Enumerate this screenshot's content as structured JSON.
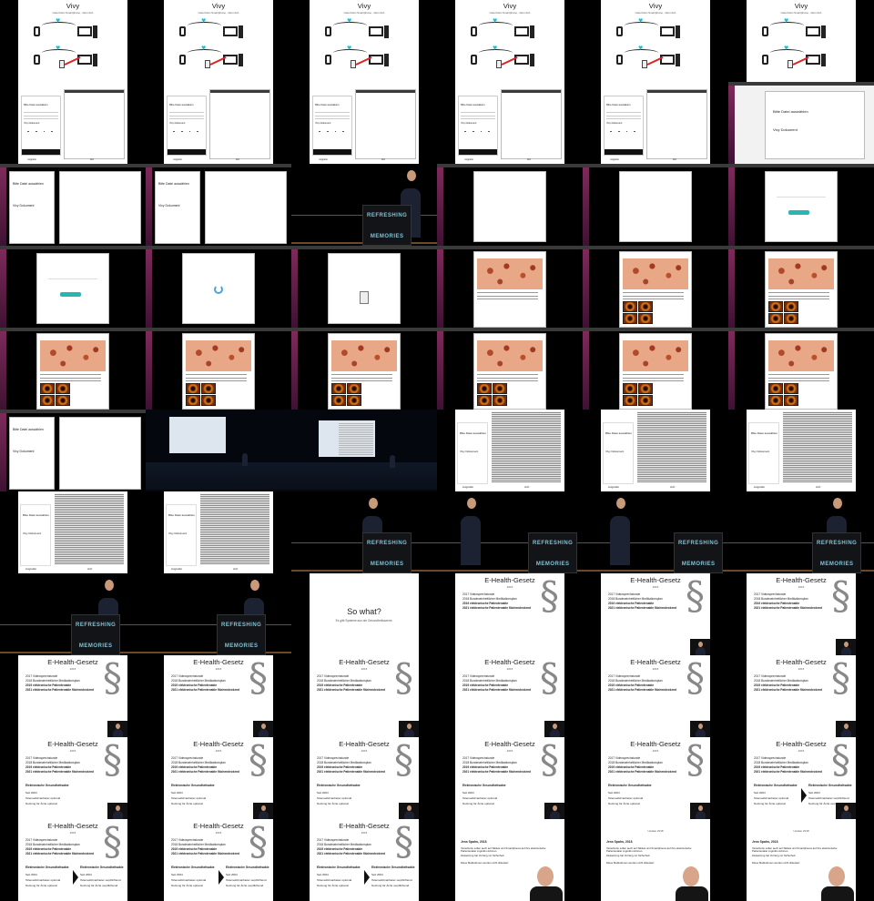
{
  "vivy": {
    "title": "Vivy",
    "subtitle": "Lässt Dein Smartphone - Dein Arzt",
    "labels": [
      "Patient",
      "Arzt",
      "Angreifer"
    ],
    "phone_buttons": [
      "Angreifer",
      "Arzt"
    ]
  },
  "web": {
    "heading": "Bitte Datei auswählen",
    "sub": "Vivy Dokument",
    "upload_button": "Hochladen"
  },
  "stage": {
    "podium_line1": "REFRESHING",
    "podium_line2": "MEMORIES"
  },
  "sowhat": {
    "title": "So what?",
    "sub": "Es gibt Systeme aus der Gesundheitsszene."
  },
  "ehealth": {
    "title": "E-Health-Gesetz",
    "year": "2015",
    "items": [
      "2017 Videosprechstunde",
      "2018 Bundeseinheitlicher Medikationsplan",
      "2019 elektronische Patientenakte",
      "2021 elektronische Patientenakte flächendeckend"
    ],
    "box_title": "Elektronische Gesundheitsakte",
    "box_items": [
      "Seit 2004",
      "Telemedizinanbieter optional",
      "Nutzung für Ärzte optional"
    ],
    "box2_items": [
      "Telemedizinanbieter verpflichtend",
      "Nutzung für Ärzte verpflichtend"
    ],
    "section_symbol": "§"
  },
  "spahn": {
    "author": "Jens Spahn, 2018",
    "sub": "Update 2018",
    "bullets": [
      "Versicherte sollen auch auf Tablets und Smartphones auf ihre elektronische Patientenakte zugreifen können.",
      "Zielsetzung hat Vorrang vor Sicherheit.",
      "Diese Maßnahmen werden nicht diskutiert."
    ]
  }
}
